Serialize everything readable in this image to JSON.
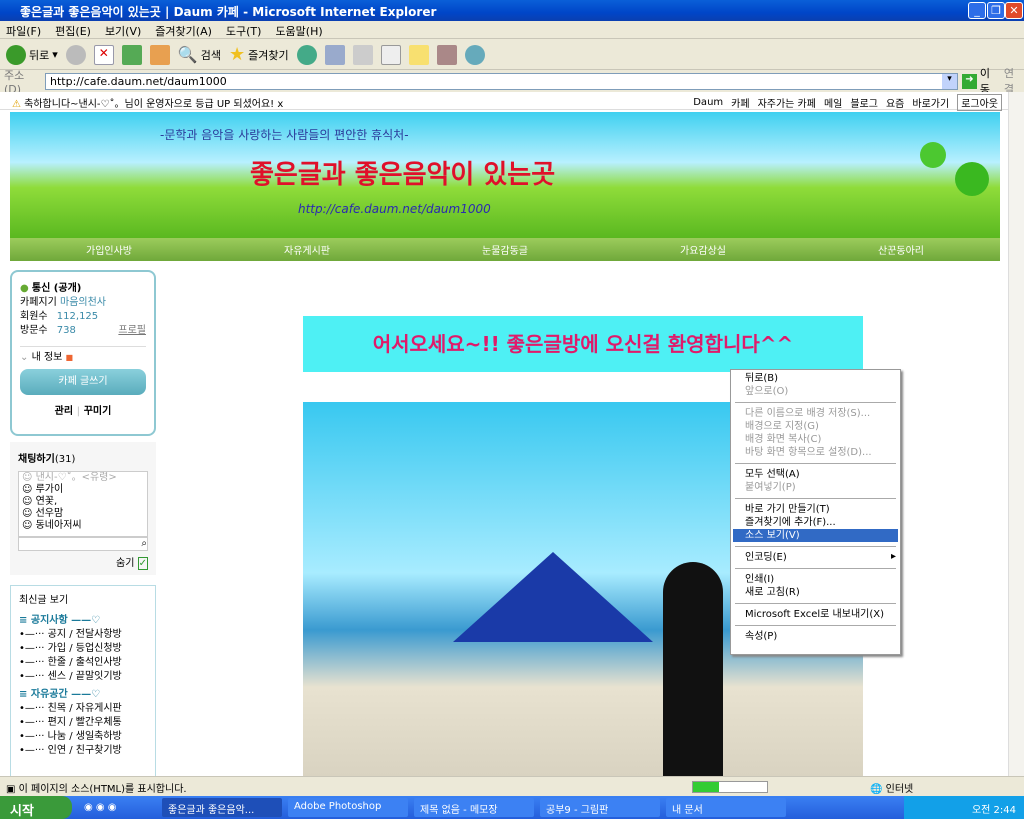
{
  "window": {
    "title": "좋은글과 좋은음악이 있는곳 | Daum 카페 - Microsoft Internet Explorer"
  },
  "menu": [
    "파일(F)",
    "편집(E)",
    "보기(V)",
    "즐겨찾기(A)",
    "도구(T)",
    "도움말(H)"
  ],
  "toolbar": {
    "back": "뒤로",
    "search": "검색",
    "favorites": "즐겨찾기"
  },
  "address": {
    "label": "주소(D)",
    "url": "http://cafe.daum.net/daum1000",
    "go": "이동",
    "links": "연결"
  },
  "notice": {
    "text": "축하합니다~낸시-♡˚。님이 운영자으로 등급 UP 되셨어요!",
    "close": "x"
  },
  "gnb": [
    "Daum",
    "카페",
    "자주가는 카페",
    "메일",
    "블로그",
    "요즘",
    "바로가기"
  ],
  "gnb_logout": "로그아웃",
  "banner": {
    "subtitle": "-문학과 음악을 사랑하는 사람들의 편안한 휴식처-",
    "title": "좋은글과 좋은음악이 있는곳",
    "url": "http://cafe.daum.net/daum1000"
  },
  "nav": [
    "가입인사방",
    "자유게시판",
    "눈물감동글",
    "가요감상실",
    "산꾼동아리"
  ],
  "profile": {
    "level": "통신 (공개)",
    "manager_label": "카페지기",
    "manager": "마음의천사",
    "members_label": "회원수",
    "members": "112,125",
    "visits_label": "방문수",
    "visits": "738",
    "profile_link": "프로필",
    "myinfo": "내 정보",
    "write": "카페 글쓰기",
    "admin": "관리",
    "decorate": "꾸미기"
  },
  "chat": {
    "title": "채팅하기",
    "count": "(31)",
    "users": [
      "낸시-♡˚。<유령>",
      "루가이",
      "연꽃,",
      "선우맘",
      "동네아저씨"
    ],
    "hide": "숨기"
  },
  "recent": {
    "title": "최신글 보기",
    "groups": [
      {
        "name": "공지사항",
        "items": [
          "공지 / 전달사항방",
          "가입 / 등업신청방",
          "한줄 / 출석인사방",
          "센스 / 끝말잇기방"
        ]
      },
      {
        "name": "자유공간",
        "items": [
          "친목 / 자유게시판",
          "편지 / 빨간우체통",
          "나눔 / 생일축하방",
          "인연 / 친구찾기방"
        ]
      }
    ]
  },
  "welcome": "어서오세요~!! 좋은글방에 오신걸 환영합니다^^",
  "context_menu": [
    {
      "label": "뒤로(B)",
      "state": "enabled"
    },
    {
      "label": "앞으로(O)",
      "state": "disabled"
    },
    {
      "sep": true
    },
    {
      "label": "다른 이름으로 배경 저장(S)...",
      "state": "disabled"
    },
    {
      "label": "배경으로 지정(G)",
      "state": "disabled"
    },
    {
      "label": "배경 화면 복사(C)",
      "state": "disabled"
    },
    {
      "label": "바탕 화면 항목으로 설정(D)...",
      "state": "disabled"
    },
    {
      "sep": true
    },
    {
      "label": "모두 선택(A)",
      "state": "enabled"
    },
    {
      "label": "붙여넣기(P)",
      "state": "disabled"
    },
    {
      "sep": true
    },
    {
      "label": "바로 가기 만들기(T)",
      "state": "enabled"
    },
    {
      "label": "즐겨찾기에 추가(F)...",
      "state": "enabled"
    },
    {
      "label": "소스 보기(V)",
      "state": "selected"
    },
    {
      "sep": true
    },
    {
      "label": "인코딩(E)",
      "state": "enabled",
      "submenu": true
    },
    {
      "sep": true
    },
    {
      "label": "인쇄(I)",
      "state": "enabled"
    },
    {
      "label": "새로 고침(R)",
      "state": "enabled"
    },
    {
      "sep": true
    },
    {
      "label": "Microsoft Excel로 내보내기(X)",
      "state": "enabled"
    },
    {
      "sep": true
    },
    {
      "label": "속성(P)",
      "state": "enabled"
    }
  ],
  "status": {
    "text": "이 페이지의 소스(HTML)를 표시합니다.",
    "zone": "인터넷",
    "progress": 0.35
  },
  "taskbar": {
    "start": "시작",
    "tasks": [
      "좋은글과 좋은음악...",
      "Adobe Photoshop",
      "제목 없음 - 메모장",
      "공부9 - 그림판",
      "내 문서"
    ],
    "clock": "오전 2:44"
  }
}
